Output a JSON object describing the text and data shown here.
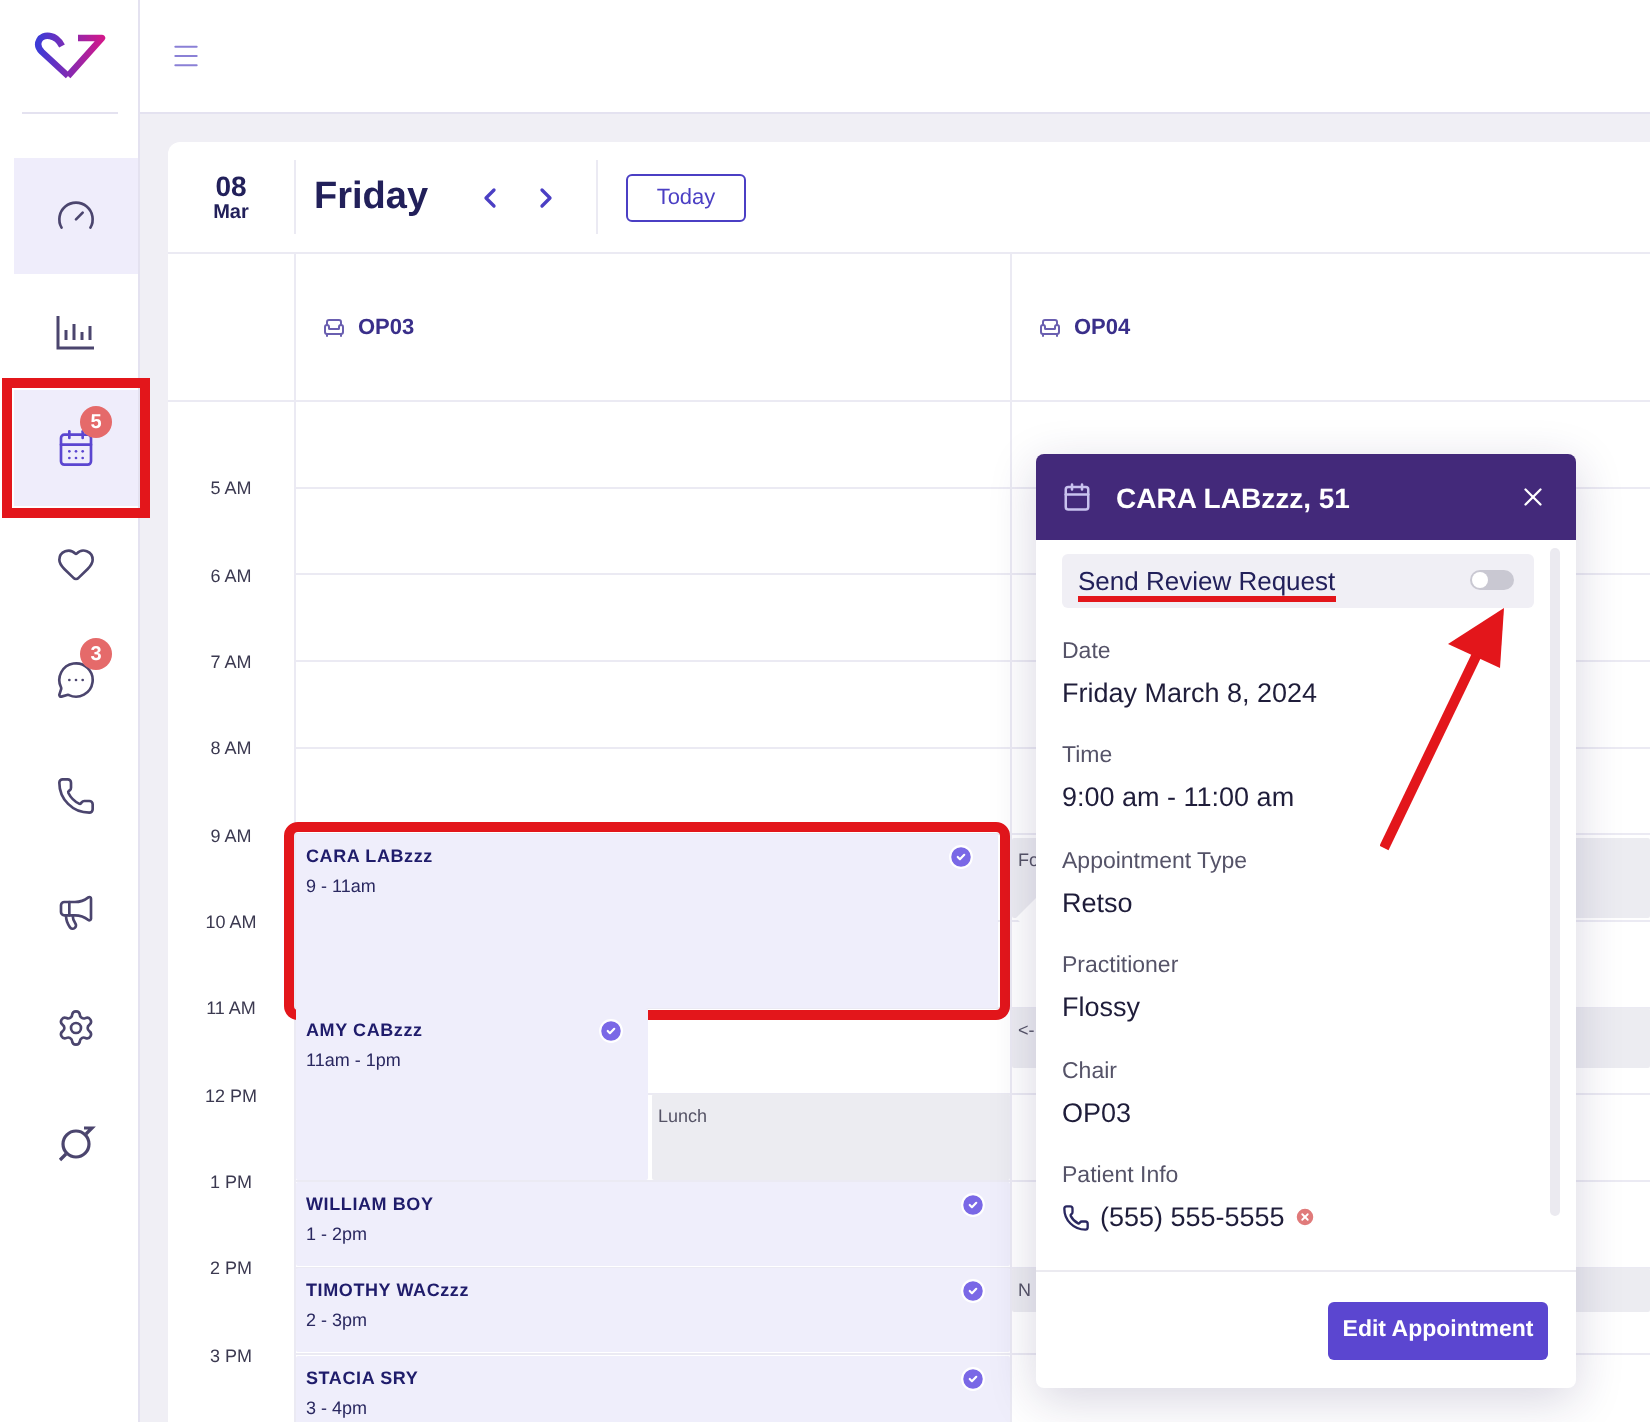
{
  "sidebar": {
    "items": [
      {
        "kind": "gauge",
        "selected": true,
        "annotated": false
      },
      {
        "kind": "chart",
        "selected": false,
        "annotated": false
      },
      {
        "kind": "calendar",
        "selected": true,
        "badge": "5",
        "annotated": true
      },
      {
        "kind": "heart",
        "selected": false,
        "annotated": false
      },
      {
        "kind": "chat",
        "selected": false,
        "badge": "3",
        "annotated": false
      },
      {
        "kind": "phone",
        "selected": false,
        "annotated": false
      },
      {
        "kind": "megaphone",
        "selected": false,
        "annotated": false
      },
      {
        "kind": "gears",
        "selected": false,
        "annotated": false
      },
      {
        "kind": "ring",
        "selected": false,
        "annotated": false
      }
    ]
  },
  "calendar": {
    "day": "08",
    "month": "Mar",
    "weekday": "Friday",
    "today_button": "Today",
    "hours": [
      "5 AM",
      "6 AM",
      "7 AM",
      "8 AM",
      "9 AM",
      "10 AM",
      "11 AM",
      "12 PM",
      "1 PM",
      "2 PM",
      "3 PM"
    ],
    "columns": [
      {
        "name": "OP03",
        "appointments": [
          {
            "kind": "patient",
            "name": "CARA LABzzz",
            "time": "9 - 11am",
            "confirmed": true,
            "annotated": true
          },
          {
            "kind": "patient",
            "name": "AMY CABzzz",
            "time": "11am - 1pm",
            "confirmed": true,
            "annotated": false
          },
          {
            "kind": "block",
            "name": "Lunch"
          },
          {
            "kind": "patient",
            "name": "WILLIAM BOY",
            "time": "1 - 2pm",
            "confirmed": true,
            "annotated": false
          },
          {
            "kind": "patient",
            "name": "TIMOTHY WACzzz",
            "time": "2 - 3pm",
            "confirmed": true,
            "annotated": false
          },
          {
            "kind": "patient",
            "name": "STACIA SRY",
            "time": "3 - 4pm",
            "confirmed": true,
            "annotated": false
          }
        ]
      },
      {
        "name": "OP04",
        "appointments": [
          {
            "kind": "block",
            "name": "Fo"
          },
          {
            "kind": "block",
            "name": "<-"
          },
          {
            "kind": "block",
            "name": "N"
          }
        ]
      }
    ]
  },
  "popup": {
    "title": "CARA LABzzz, 51",
    "review_toggle": {
      "label": "Send Review Request",
      "on": false,
      "underlined": true,
      "arrow": true
    },
    "fields": [
      {
        "kind": "text",
        "label": "Date",
        "value": "Friday March 8, 2024"
      },
      {
        "kind": "text",
        "label": "Time",
        "value": "9:00 am - 11:00 am"
      },
      {
        "kind": "text",
        "label": "Appointment Type",
        "value": "Retso"
      },
      {
        "kind": "text",
        "label": "Practitioner",
        "value": "Flossy"
      },
      {
        "kind": "text",
        "label": "Chair",
        "value": "OP03"
      },
      {
        "kind": "phone",
        "label": "Patient Info",
        "value": "(555) 555-5555"
      }
    ],
    "button": "Edit Appointment"
  }
}
